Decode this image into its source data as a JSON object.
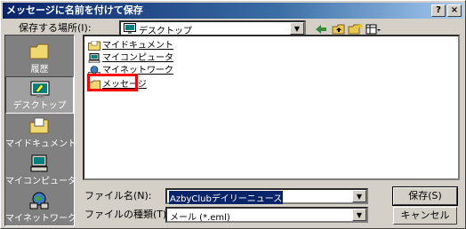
{
  "window": {
    "title": "メッセージに名前を付けて保存"
  },
  "titlebar": {
    "help": "?",
    "close": "×"
  },
  "location": {
    "label": "保存する場所(I):",
    "value": "デスクトップ"
  },
  "places": [
    {
      "name": "recent",
      "label": "履歴",
      "selected": false
    },
    {
      "name": "desktop",
      "label": "デスクトップ",
      "selected": true
    },
    {
      "name": "mydocs",
      "label": "マイドキュメント",
      "selected": false
    },
    {
      "name": "mycomputer",
      "label": "マイコンピュータ",
      "selected": false
    },
    {
      "name": "network",
      "label": "マイネットワーク",
      "selected": false
    }
  ],
  "files": [
    {
      "label": "マイドキュメント",
      "icon": "documents-folder-icon"
    },
    {
      "label": "マイコンピュータ",
      "icon": "computer-icon"
    },
    {
      "label": "マイネットワーク",
      "icon": "network-icon"
    },
    {
      "label": "メッセージ",
      "icon": "folder-icon"
    }
  ],
  "filename": {
    "label": "ファイル名(N):",
    "value": "AzbyClubデイリーニュース"
  },
  "filetype": {
    "label": "ファイルの種類(T):",
    "value": "メール (*.eml)"
  },
  "buttons": {
    "save": "保存(S)",
    "cancel": "キャンセル"
  },
  "colors": {
    "titlebar": "#0a246a",
    "highlight": "#ff0000",
    "face": "#d4d0c8"
  }
}
